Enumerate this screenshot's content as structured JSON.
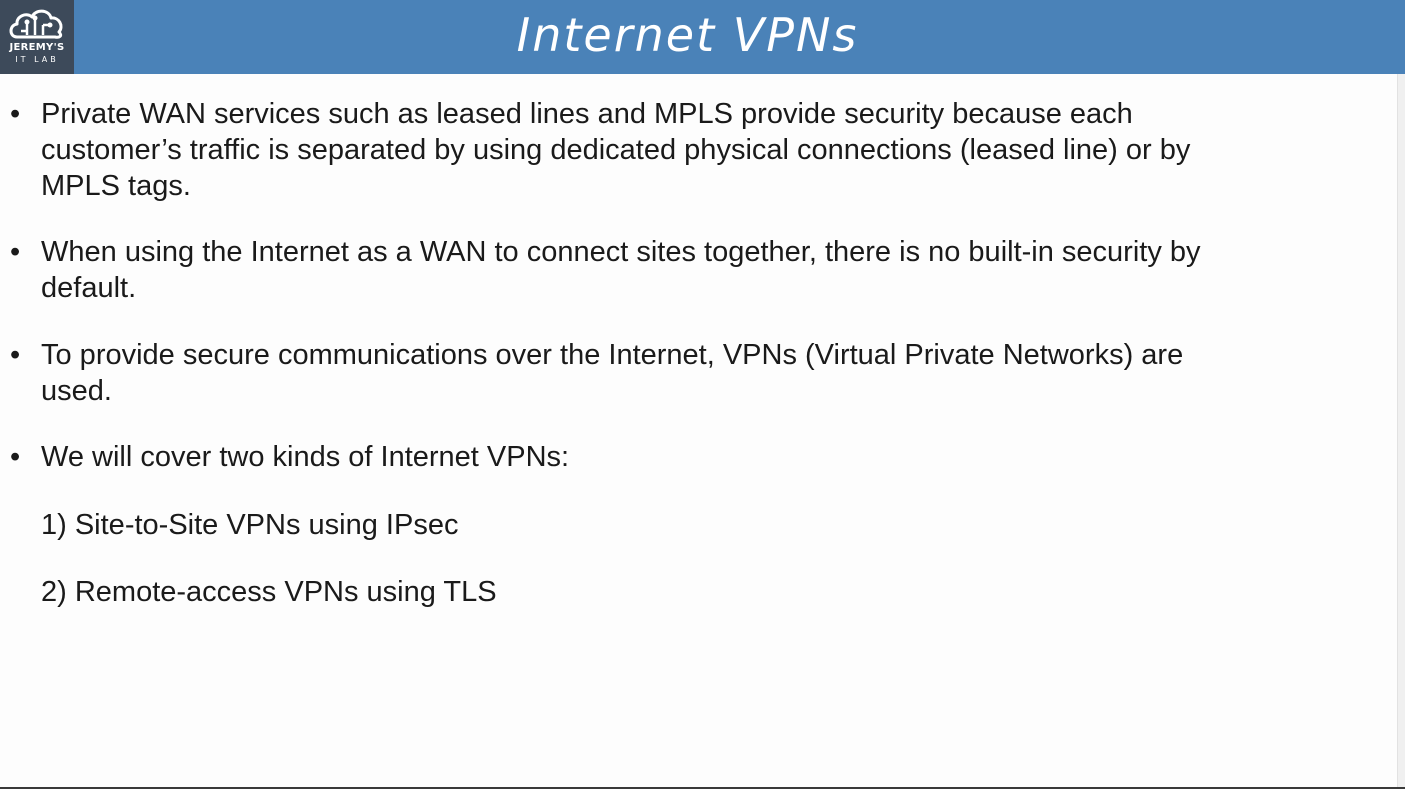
{
  "slide": {
    "title": "Internet VPNs",
    "logo": {
      "line1": "JEREMY'S",
      "line2": "IT LAB",
      "icon": "cloud-circuit-icon"
    },
    "bullets": [
      {
        "lines": [
          "Private WAN services such as leased lines and MPLS provide security because each",
          "customer’s traffic is separated by using dedicated physical connections (leased line) or by",
          "MPLS tags."
        ]
      },
      {
        "lines": [
          "When using the Internet as a WAN to connect sites together, there is no built-in security by",
          "default."
        ]
      },
      {
        "lines": [
          "To provide secure communications over the Internet, VPNs (Virtual Private Networks) are",
          "used."
        ]
      },
      {
        "lines": [
          "We will cover two kinds of Internet VPNs:"
        ]
      }
    ],
    "sub_items": [
      "1) Site-to-Site VPNs using IPsec",
      "2) Remote-access VPNs using TLS"
    ],
    "bullet_glyph": "•",
    "colors": {
      "title_bar": "#4a82b8",
      "logo_bg": "#3d4a5a",
      "text": "#1a1a1a"
    }
  }
}
